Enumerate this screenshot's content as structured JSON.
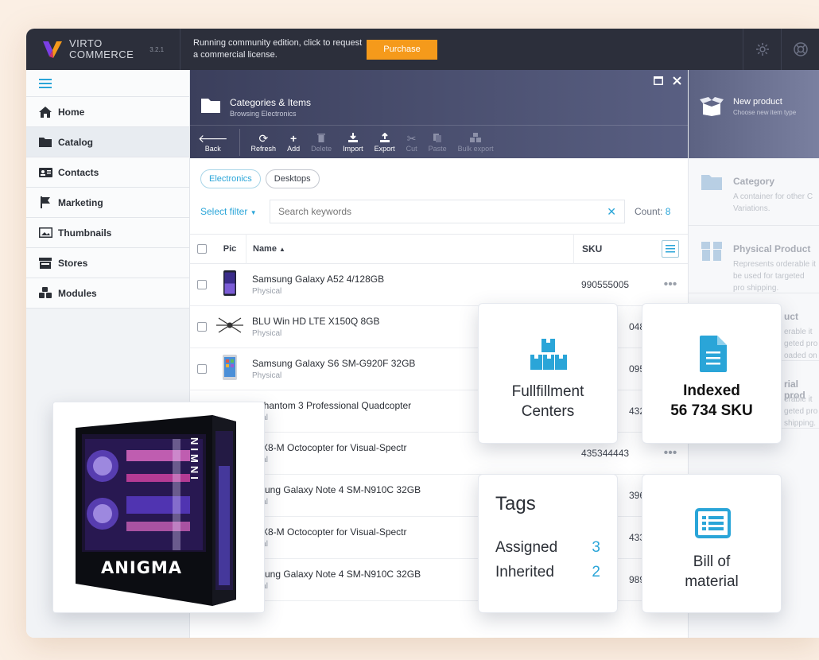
{
  "topbar": {
    "logo_line1": "VIRTO",
    "logo_line2": "COMMERCE",
    "version": "3.2.1",
    "message": "Running community edition, click to request a commercial license.",
    "purchase_label": "Purchase",
    "brand_colors": {
      "orange": "#f59a1b",
      "purple": "#7b3fe4",
      "dark": "#2c2f3b"
    }
  },
  "sidebar": {
    "items": [
      {
        "label": "Home",
        "icon": "home-icon"
      },
      {
        "label": "Catalog",
        "icon": "folder-icon"
      },
      {
        "label": "Contacts",
        "icon": "contact-card-icon"
      },
      {
        "label": "Marketing",
        "icon": "flag-icon"
      },
      {
        "label": "Thumbnails",
        "icon": "image-icon"
      },
      {
        "label": "Stores",
        "icon": "store-icon"
      },
      {
        "label": "Modules",
        "icon": "cubes-icon"
      }
    ]
  },
  "blade": {
    "title": "Categories & Items",
    "subtitle": "Browsing Electronics",
    "toolbar": {
      "back": "Back",
      "refresh": "Refresh",
      "add": "Add",
      "delete": "Delete",
      "import": "Import",
      "export": "Export",
      "cut": "Cut",
      "paste": "Paste",
      "bulk_export": "Bulk export"
    },
    "chips": [
      "Electronics",
      "Desktops"
    ],
    "select_filter": "Select filter",
    "search_placeholder": "Search keywords",
    "count_label": "Count:",
    "count_value": "8",
    "columns": {
      "pic": "Pic",
      "name": "Name",
      "sku": "SKU"
    },
    "rows": [
      {
        "name": "Samsung Galaxy A52 4/128GB",
        "type": "Physical",
        "sku": "990555005"
      },
      {
        "name": "BLU Win HD LTE X150Q 8GB",
        "type": "Physical",
        "sku": "048"
      },
      {
        "name": "Samsung Galaxy S6 SM-G920F 32GB",
        "type": "Physical",
        "sku": "095"
      },
      {
        "name": "I Phantom 3 Professional Quadcopter",
        "type": "sical",
        "sku": "432"
      },
      {
        "name": "R X8-M Octocopter for Visual-Spectr",
        "type": "sical",
        "sku": "435344443"
      },
      {
        "name": "msung Galaxy Note 4 SM-N910C 32GB",
        "type": "sical",
        "sku": "396"
      },
      {
        "name": "R X8-M Octocopter for Visual-Spectr",
        "type": "sical",
        "sku": "433"
      },
      {
        "name": "msung Galaxy Note 4 SM-N910C 32GB",
        "type": "sical",
        "sku": "989"
      }
    ]
  },
  "right_blade": {
    "title": "New product",
    "subtitle": "Choose new item type",
    "items": [
      {
        "title": "Category",
        "desc": "A container for other C Variations."
      },
      {
        "title": "Physical Product",
        "desc": "Represents orderable it be used for targeted pro shipping."
      },
      {
        "title": "uct",
        "desc": "erable it geted pro oaded on"
      },
      {
        "title": "rial prod",
        "desc": "erable it geted pro shipping."
      }
    ]
  },
  "cards": {
    "fulfillment": {
      "line1": "Fullfillment",
      "line2": "Centers"
    },
    "indexed": {
      "line1": "Indexed",
      "line2": "56 734 SKU"
    },
    "tags": {
      "title": "Tags",
      "assigned_label": "Assigned",
      "assigned_value": "3",
      "inherited_label": "Inherited",
      "inherited_value": "2"
    },
    "bom": {
      "line1": "Bill of",
      "line2": "material"
    },
    "pc": {
      "brand": "ANIGMA",
      "side_text": "NIMNI"
    }
  }
}
